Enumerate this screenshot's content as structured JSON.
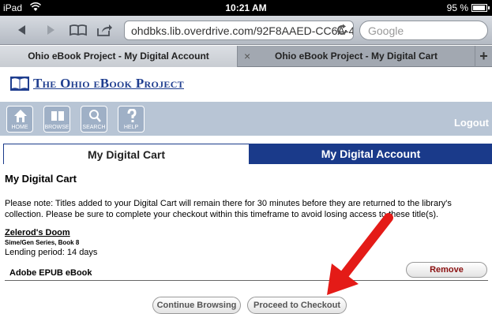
{
  "status": {
    "device": "iPad",
    "time": "10:21 AM",
    "battery": "95 %"
  },
  "browser": {
    "url": "ohdbks.lib.overdrive.com/92F8AAED-CC6A-4DC",
    "search_placeholder": "Google",
    "tabs": [
      {
        "title": "Ohio eBook Project - My Digital Account"
      },
      {
        "title": "Ohio eBook Project - My Digital Cart"
      }
    ],
    "close_glyph": "×",
    "new_tab_glyph": "+"
  },
  "site": {
    "logo_text": "The Ohio eBook Project",
    "nav": [
      "HOME",
      "BROWSE",
      "SEARCH",
      "HELP"
    ],
    "logout": "Logout",
    "page_tabs": {
      "cart": "My Digital Cart",
      "account": "My Digital Account"
    }
  },
  "cart": {
    "heading": "My Digital Cart",
    "note": "Please note: Titles added to your Digital Cart will remain there for 30 minutes before they are returned to the library's collection. Please be sure to complete your checkout within this timeframe to avoid losing access to these title(s).",
    "item": {
      "title": "Zelerod's Doom",
      "series": "Sime/Gen Series, Book 8",
      "lending": "Lending period: 14 days",
      "format": "Adobe EPUB eBook",
      "remove_label": "Remove"
    },
    "continue_label": "Continue Browsing",
    "checkout_label": "Proceed to Checkout"
  },
  "colors": {
    "nav_band": "#b8c5d5",
    "brand_blue": "#1a3a8a",
    "annotation_arrow": "#e41b17"
  }
}
